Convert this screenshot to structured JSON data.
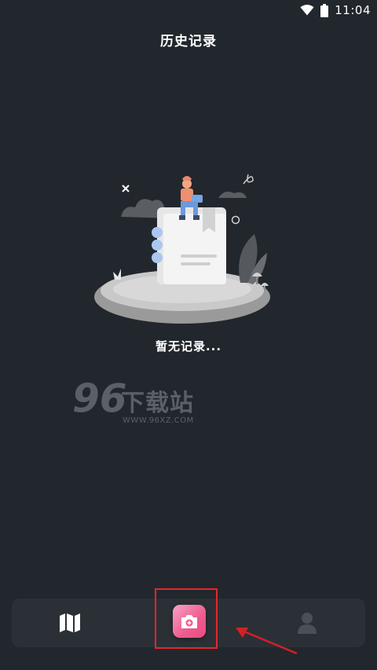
{
  "status_bar": {
    "time": "11:04",
    "icons": [
      "wifi-icon",
      "battery-icon"
    ]
  },
  "header": {
    "title": "历史记录"
  },
  "empty_state": {
    "illustration": "notebook-person-illustration",
    "message": "暂无记录..."
  },
  "watermark": {
    "digits": "96",
    "name": "下载站",
    "url": "WWW.96XZ.COM"
  },
  "tab_bar": {
    "items": [
      {
        "icon": "map-icon"
      },
      {
        "icon": "camera-add-icon"
      },
      {
        "icon": "user-icon"
      }
    ]
  },
  "annotation": {
    "highlight_color": "#e8262b",
    "arrow_color": "#d42027"
  },
  "colors": {
    "background": "#22272d",
    "tab_bar": "#2b3036",
    "camera_gradient_start": "#f7a2c7",
    "camera_gradient_end": "#e94b80"
  }
}
